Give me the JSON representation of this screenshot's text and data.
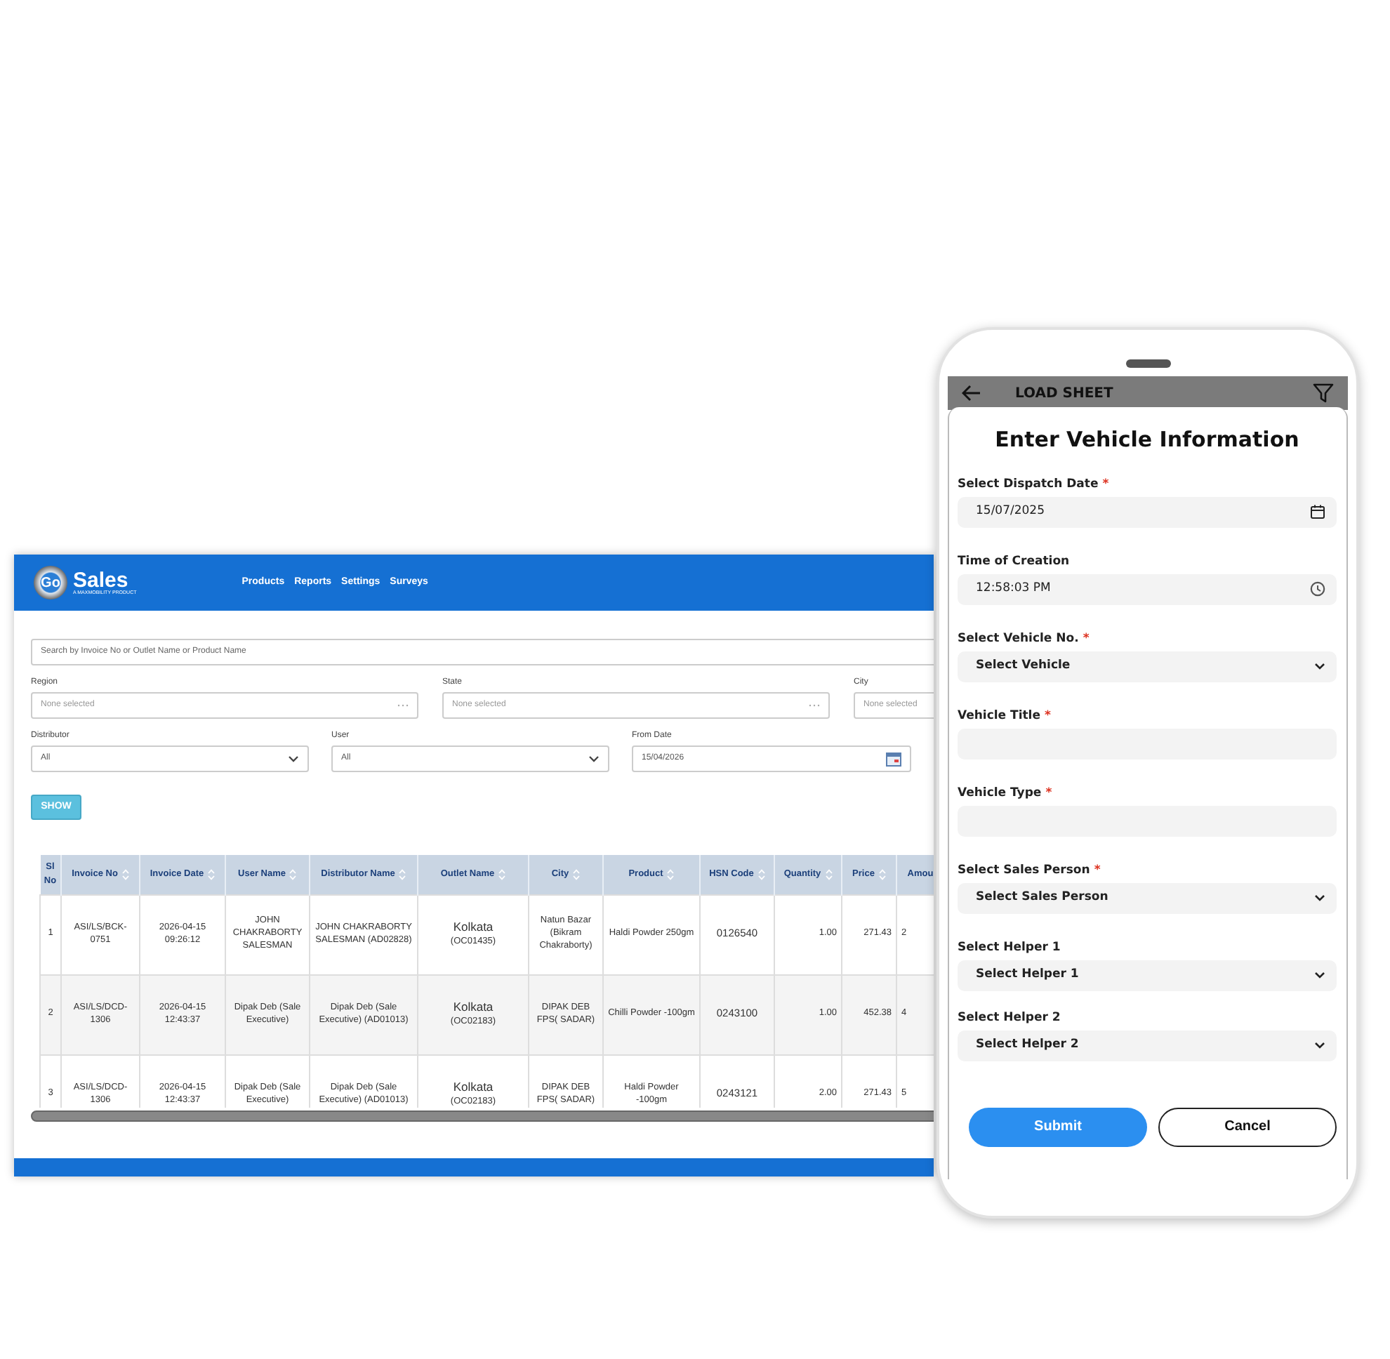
{
  "desktop": {
    "logo": {
      "mark": "Go",
      "brand": "Sales",
      "tagline": "A MAXMOBILITY PRODUCT"
    },
    "nav": [
      "Products",
      "Reports",
      "Settings",
      "Surveys"
    ],
    "search": {
      "placeholder": "Search by Invoice No or Outlet Name or Product Name"
    },
    "filter_rows": [
      [
        {
          "label": "Region",
          "kind": "multiselect",
          "placeholder": "None selected"
        },
        {
          "label": "State",
          "kind": "multiselect",
          "placeholder": "None selected"
        },
        {
          "label": "City",
          "kind": "multiselect",
          "placeholder": "None selected"
        }
      ],
      [
        {
          "label": "Distributor",
          "kind": "select",
          "value": "All"
        },
        {
          "label": "User",
          "kind": "select",
          "value": "All"
        },
        {
          "label": "From Date",
          "kind": "date",
          "value": "15/04/2026"
        }
      ]
    ],
    "show_button": "SHOW",
    "table": {
      "columns": [
        "Sl No",
        "Invoice No",
        "Invoice Date",
        "User Name",
        "Distributor Name",
        "Outlet Name",
        "City",
        "Product",
        "HSN Code",
        "Quantity",
        "Price",
        "Amou"
      ],
      "rows": [
        {
          "sl": "1",
          "invoice_no": "ASI/LS/BCK-0751",
          "invoice_date": "2026-04-15 09:26:12",
          "user_name": "JOHN CHAKRABORTY SALESMAN",
          "distributor_name": "JOHN CHAKRABORTY SALESMAN (AD02828)",
          "outlet_name": "Kolkata",
          "outlet_code": "(OC01435)",
          "city": "Natun Bazar (Bikram Chakraborty)",
          "product": "Haldi Powder 250gm",
          "hsn_code": "0126540",
          "quantity": "1.00",
          "price": "271.43",
          "amount": "2"
        },
        {
          "sl": "2",
          "invoice_no": "ASI/LS/DCD-1306",
          "invoice_date": "2026-04-15 12:43:37",
          "user_name": "Dipak Deb (Sale Executive)",
          "distributor_name": "Dipak Deb (Sale Executive) (AD01013)",
          "outlet_name": "Kolkata",
          "outlet_code": "(OC02183)",
          "city": "DIPAK DEB FPS( SADAR)",
          "product": "Chilli Powder -100gm",
          "hsn_code": "0243100",
          "quantity": "1.00",
          "price": "452.38",
          "amount": "4"
        },
        {
          "sl": "3",
          "invoice_no": "ASI/LS/DCD-1306",
          "invoice_date": "2026-04-15 12:43:37",
          "user_name": "Dipak Deb (Sale Executive)",
          "distributor_name": "Dipak Deb (Sale Executive) (AD01013)",
          "outlet_name": "Kolkata",
          "outlet_code": "(OC02183)",
          "city": "DIPAK DEB FPS( SADAR)",
          "product": "Haldi Powder -100gm",
          "hsn_code": "0243121",
          "quantity": "2.00",
          "price": "271.43",
          "amount": "5"
        }
      ]
    }
  },
  "phone": {
    "title": "LOAD SHEET",
    "heading": "Enter Vehicle Information",
    "fields": [
      {
        "label": "Select Dispatch Date",
        "required_mark": "*",
        "kind": "date",
        "value": "15/07/2025"
      },
      {
        "label": "Time of Creation",
        "kind": "time",
        "value": "12:58:03 PM"
      },
      {
        "label": "Select Vehicle No.",
        "required_mark": "*",
        "kind": "select",
        "value": "Select Vehicle"
      },
      {
        "label": "Vehicle Title",
        "required_mark": "*",
        "kind": "text"
      },
      {
        "label": "Vehicle Type",
        "required_mark": "*",
        "kind": "text"
      },
      {
        "label": "Select Sales Person",
        "required_mark": "*",
        "kind": "select",
        "value": "Select Sales Person"
      },
      {
        "label": "Select Helper 1",
        "kind": "select",
        "value": "Select Helper 1"
      },
      {
        "label": "Select Helper 2",
        "kind": "select",
        "value": "Select Helper 2"
      }
    ],
    "buttons": [
      {
        "label": "Submit",
        "kind": "primary"
      },
      {
        "label": "Cancel",
        "kind": "outline"
      }
    ]
  }
}
